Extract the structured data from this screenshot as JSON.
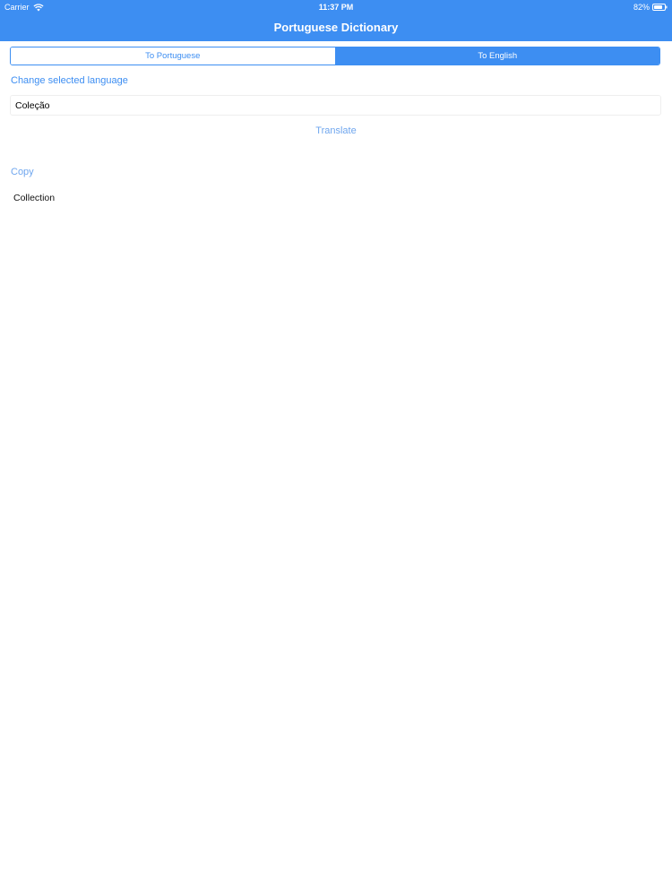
{
  "status_bar": {
    "carrier": "Carrier",
    "time": "11:37 PM",
    "battery": "82%",
    "battery_level": 0.82
  },
  "nav": {
    "title": "Portuguese Dictionary"
  },
  "segmented": {
    "options": [
      "To Portuguese",
      "To English"
    ],
    "selected": "To English"
  },
  "change_language_label": "Change selected language",
  "input": {
    "value": "Coleção"
  },
  "translate_label": "Translate",
  "copy_label": "Copy",
  "result": "Collection",
  "colors": {
    "accent": "#3d8ef2",
    "link_light": "#6fa6ee"
  }
}
